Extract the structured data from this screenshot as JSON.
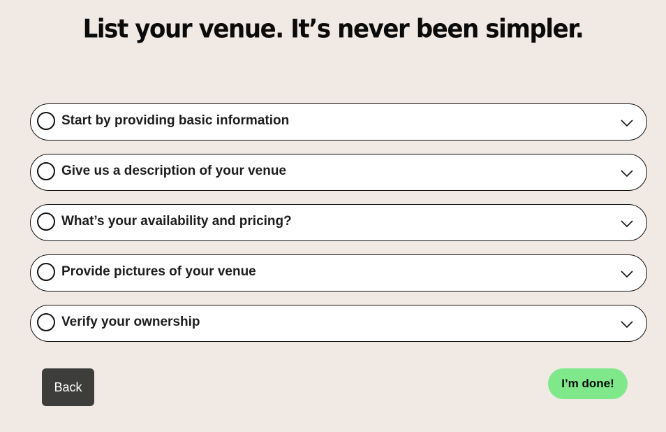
{
  "page": {
    "title": "List your venue. It’s never been simpler."
  },
  "steps": [
    {
      "label": "Start by providing basic information",
      "status_icon": "empty-circle-icon",
      "toggle_icon": "chevron-down-icon"
    },
    {
      "label": "Give us a description of your venue",
      "status_icon": "empty-circle-icon",
      "toggle_icon": "chevron-down-icon"
    },
    {
      "label": "What’s your availability and pricing?",
      "status_icon": "empty-circle-icon",
      "toggle_icon": "chevron-down-icon"
    },
    {
      "label": "Provide pictures of your venue",
      "status_icon": "empty-circle-icon",
      "toggle_icon": "chevron-down-icon"
    },
    {
      "label": "Verify your ownership",
      "status_icon": "empty-circle-icon",
      "toggle_icon": "chevron-down-icon"
    }
  ],
  "actions": {
    "back_label": "Back",
    "done_label": "I’m done!"
  },
  "colors": {
    "background": "#f1e9e3",
    "step_background": "#ffffff",
    "back_button": "#3d3d3b",
    "done_button": "#7ee88a"
  }
}
